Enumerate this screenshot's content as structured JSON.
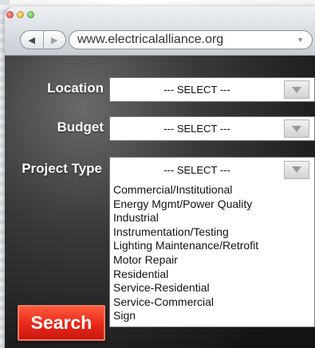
{
  "browser": {
    "url": "www.electricalalliance.org"
  },
  "form": {
    "location": {
      "label": "Location",
      "value": "--- SELECT ---"
    },
    "budget": {
      "label": "Budget",
      "value": "--- SELECT ---"
    },
    "project_type": {
      "label": "Project Type",
      "value": "--- SELECT ---",
      "options": [
        "Commercial/Institutional",
        "Energy Mgmt/Power Quality",
        "Industrial",
        "Instrumentation/Testing",
        "Lighting Maintenance/Retrofit",
        "Motor Repair",
        "Residential",
        "Service-Residential",
        "Service-Commercial",
        "Sign"
      ]
    },
    "search_label": "Search"
  },
  "colors": {
    "accent": "#e8281a",
    "background": "#141414"
  }
}
